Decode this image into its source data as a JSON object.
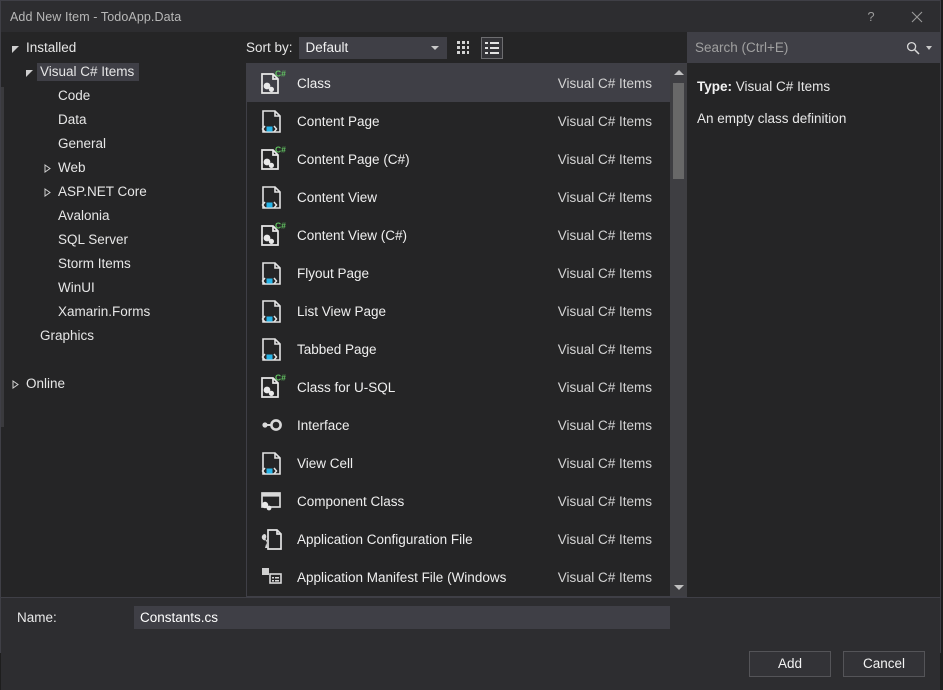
{
  "window": {
    "title": "Add New Item - TodoApp.Data",
    "help_label": "?",
    "close_label": "×"
  },
  "sidebar": {
    "items": [
      {
        "label": "Installed",
        "level": 0,
        "twisty": "expanded",
        "selected": false
      },
      {
        "label": "Visual C# Items",
        "level": 1,
        "twisty": "expanded",
        "selected": true
      },
      {
        "label": "Code",
        "level": 2,
        "twisty": "none",
        "selected": false
      },
      {
        "label": "Data",
        "level": 2,
        "twisty": "none",
        "selected": false
      },
      {
        "label": "General",
        "level": 2,
        "twisty": "none",
        "selected": false
      },
      {
        "label": "Web",
        "level": 2,
        "twisty": "collapsed",
        "selected": false
      },
      {
        "label": "ASP.NET Core",
        "level": 2,
        "twisty": "collapsed",
        "selected": false
      },
      {
        "label": "Avalonia",
        "level": 2,
        "twisty": "none",
        "selected": false
      },
      {
        "label": "SQL Server",
        "level": 2,
        "twisty": "none",
        "selected": false
      },
      {
        "label": "Storm Items",
        "level": 2,
        "twisty": "none",
        "selected": false
      },
      {
        "label": "WinUI",
        "level": 2,
        "twisty": "none",
        "selected": false
      },
      {
        "label": "Xamarin.Forms",
        "level": 2,
        "twisty": "none",
        "selected": false
      },
      {
        "label": "Graphics",
        "level": 1,
        "twisty": "none",
        "selected": false
      },
      {
        "label": "",
        "level": 0,
        "twisty": "none",
        "selected": false
      },
      {
        "label": "Online",
        "level": 0,
        "twisty": "collapsed",
        "selected": false
      }
    ]
  },
  "toolbar": {
    "sort_label": "Sort by:",
    "sort_value": "Default",
    "tiles_view_icon": "grid-view-icon",
    "list_view_icon": "list-view-icon",
    "list_view_active": true
  },
  "search": {
    "placeholder": "Search (Ctrl+E)",
    "value": "",
    "icon": "search-icon"
  },
  "list": {
    "category_label": "Visual C# Items",
    "items": [
      {
        "name": "Class",
        "category": "Visual C# Items",
        "icon": "csharp-class-icon",
        "selected": true
      },
      {
        "name": "Content Page",
        "category": "Visual C# Items",
        "icon": "xaml-page-icon",
        "selected": false
      },
      {
        "name": "Content Page (C#)",
        "category": "Visual C# Items",
        "icon": "csharp-class-icon",
        "selected": false
      },
      {
        "name": "Content View",
        "category": "Visual C# Items",
        "icon": "xaml-page-icon",
        "selected": false
      },
      {
        "name": "Content View (C#)",
        "category": "Visual C# Items",
        "icon": "csharp-class-icon",
        "selected": false
      },
      {
        "name": "Flyout Page",
        "category": "Visual C# Items",
        "icon": "xaml-page-icon",
        "selected": false
      },
      {
        "name": "List View Page",
        "category": "Visual C# Items",
        "icon": "xaml-page-icon",
        "selected": false
      },
      {
        "name": "Tabbed Page",
        "category": "Visual C# Items",
        "icon": "xaml-page-icon",
        "selected": false
      },
      {
        "name": "Class for U-SQL",
        "category": "Visual C# Items",
        "icon": "csharp-class-icon",
        "selected": false
      },
      {
        "name": "Interface",
        "category": "Visual C# Items",
        "icon": "interface-icon",
        "selected": false
      },
      {
        "name": "View Cell",
        "category": "Visual C# Items",
        "icon": "xaml-page-icon",
        "selected": false
      },
      {
        "name": "Component Class",
        "category": "Visual C# Items",
        "icon": "component-class-icon",
        "selected": false
      },
      {
        "name": "Application Configuration File",
        "category": "Visual C# Items",
        "icon": "config-file-icon",
        "selected": false
      },
      {
        "name": "Application Manifest File (Windows",
        "category": "Visual C# Items",
        "icon": "manifest-file-icon",
        "selected": false
      }
    ]
  },
  "details": {
    "type_key": "Type:",
    "type_value": "Visual C# Items",
    "description": "An empty class definition"
  },
  "footer": {
    "name_label": "Name:",
    "name_value": "Constants.cs",
    "name_placeholder": "",
    "add_label": "Add",
    "cancel_label": "Cancel"
  },
  "colors": {
    "window_bg": "#2d2d30",
    "pane_bg": "#252526",
    "selection": "#3f3f46",
    "border": "#3f3f46",
    "text": "#f1f1f1",
    "csharp_badge": "#62c462",
    "xaml_marker": "#27b5e8"
  }
}
